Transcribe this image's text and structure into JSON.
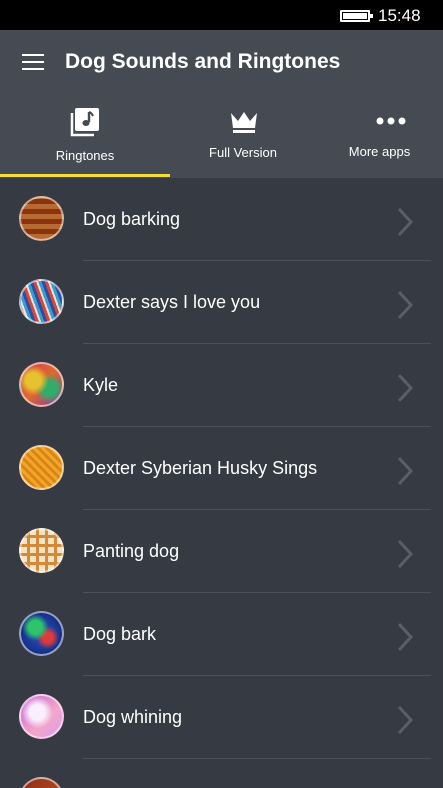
{
  "status_bar": {
    "time": "15:48"
  },
  "header": {
    "title": "Dog Sounds and Ringtones"
  },
  "tabs": [
    {
      "label": "Ringtones",
      "icon": "music-note-icon",
      "selected": true
    },
    {
      "label": "Full Version",
      "icon": "crown-icon",
      "selected": false
    },
    {
      "label": "More apps",
      "icon": "more-dots-icon",
      "selected": false
    }
  ],
  "colors": {
    "accent": "#f4df39",
    "header_bg": "#464a52",
    "list_bg": "#363a42"
  },
  "ringtones": [
    {
      "label": "Dog barking"
    },
    {
      "label": "Dexter says I love you"
    },
    {
      "label": "Kyle"
    },
    {
      "label": "Dexter Syberian Husky Sings"
    },
    {
      "label": "Panting dog"
    },
    {
      "label": "Dog bark"
    },
    {
      "label": "Dog whining"
    }
  ]
}
